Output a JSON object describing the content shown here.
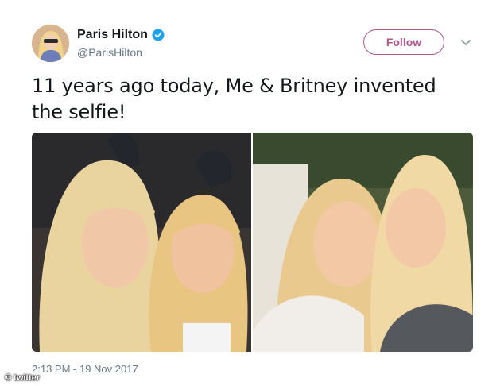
{
  "user": {
    "display_name": "Paris Hilton",
    "handle": "@ParisHilton",
    "verified_icon": "verified-badge-icon",
    "avatar_icon": "profile-avatar"
  },
  "actions": {
    "follow_label": "Follow",
    "menu_icon": "chevron-down-icon"
  },
  "tweet": {
    "text": "11 years ago today, Me & Britney invented the selfie!",
    "timestamp": "2:13 PM - 19 Nov 2017"
  },
  "media": {
    "count": 2
  },
  "watermark": {
    "text": "© twitter"
  },
  "colors": {
    "follow_accent": "#b0568b",
    "verified_blue": "#1da1f2",
    "secondary_text": "#657786"
  }
}
